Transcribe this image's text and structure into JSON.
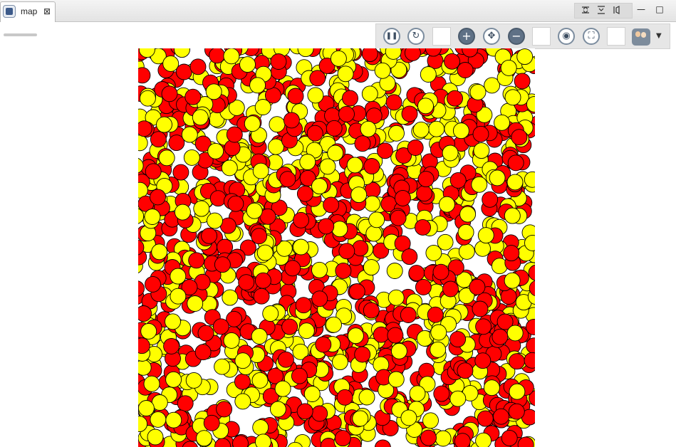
{
  "tab": {
    "label": "map",
    "close_glyph": "⊠",
    "icon": "map-view-icon"
  },
  "window_controls": {
    "icons": [
      "pin-icon",
      "pin-all-icon",
      "dock-icon"
    ],
    "minimize_glyph": "—",
    "maximize_glyph": "□"
  },
  "toolbar": {
    "items": [
      {
        "type": "button",
        "icon": "pause-icon",
        "glyph": "❚❚"
      },
      {
        "type": "button",
        "icon": "refresh-icon",
        "glyph": "↻"
      },
      {
        "type": "swatch",
        "icon": "color-swatch-1"
      },
      {
        "type": "button",
        "icon": "zoom-in-icon",
        "glyph": "+",
        "dark": true
      },
      {
        "type": "button",
        "icon": "zoom-fit-icon",
        "glyph": "✥"
      },
      {
        "type": "button",
        "icon": "zoom-out-icon",
        "glyph": "−",
        "dark": true
      },
      {
        "type": "swatch",
        "icon": "color-swatch-2"
      },
      {
        "type": "button",
        "icon": "snapshot-icon",
        "glyph": "◉"
      },
      {
        "type": "button",
        "icon": "fullscreen-icon",
        "glyph": "⛶"
      },
      {
        "type": "swatch",
        "icon": "color-swatch-3"
      },
      {
        "type": "button",
        "icon": "agents-icon"
      },
      {
        "type": "dropdown",
        "icon": "dropdown-arrow-icon",
        "glyph": "▼"
      }
    ]
  },
  "map": {
    "colors": {
      "red": "#ff0000",
      "yellow": "#ffff00",
      "outline": "#000000"
    },
    "agent_types": [
      "red",
      "yellow"
    ]
  }
}
